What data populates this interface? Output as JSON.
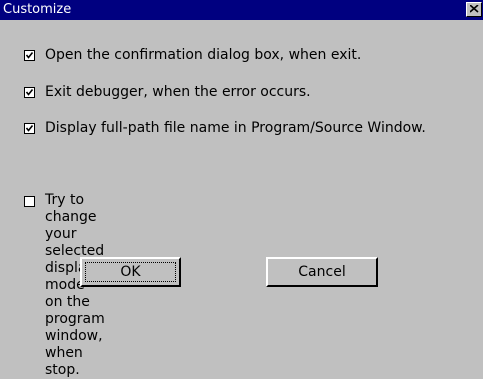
{
  "window": {
    "title": "Customize",
    "close_icon": "close-icon"
  },
  "options": [
    {
      "label": "Open the confirmation dialog box, when exit.",
      "checked": true
    },
    {
      "label": "Exit debugger, when the error occurs.",
      "checked": true
    },
    {
      "label": "Display full-path file name in Program/Source Window.",
      "checked": true
    },
    {
      "label": "Try to change your selected display mode on the\nprogram window, when stop.",
      "checked": false
    }
  ],
  "buttons": {
    "ok_label": "OK",
    "cancel_label": "Cancel"
  }
}
